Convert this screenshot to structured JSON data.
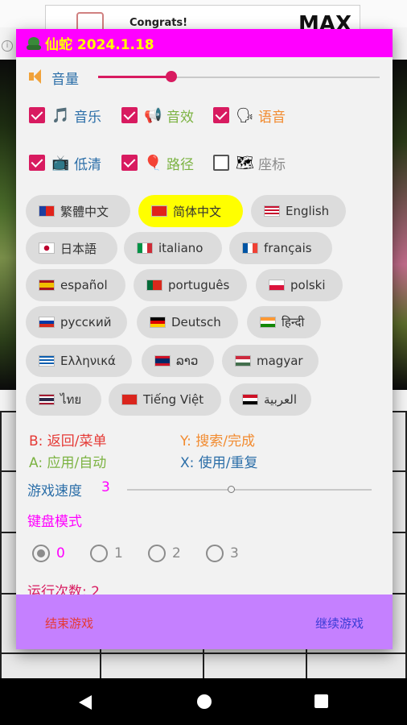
{
  "banner": {
    "title": "Congrats!",
    "badge": "MAX"
  },
  "info_icon": "i",
  "dialog": {
    "title": "仙蛇 2024.1.18",
    "volume": {
      "label": "音量",
      "level": 0.26
    },
    "checks_row1": [
      {
        "icon": "music-note-icon",
        "glyph": "🎵",
        "label": "音乐",
        "checked": true,
        "color": "#2b6ea8"
      },
      {
        "icon": "megaphone-icon",
        "glyph": "📢",
        "label": "音效",
        "checked": true,
        "color": "#7cb342"
      },
      {
        "icon": "speaking-head-icon",
        "glyph": "🗣",
        "label": "语音",
        "checked": true,
        "color": "#f28b30"
      }
    ],
    "checks_row2": [
      {
        "icon": "tv-icon",
        "glyph": "📺",
        "label": "低清",
        "checked": true,
        "color": "#2b6ea8"
      },
      {
        "icon": "balloon-icon",
        "glyph": "🎈",
        "label": "路径",
        "checked": true,
        "color": "#7cb342"
      },
      {
        "icon": "map-icon",
        "glyph": "🗺",
        "label": "座标",
        "checked": false,
        "color": "#8a8a8a"
      }
    ],
    "languages": [
      {
        "label": "繁體中文",
        "flag": "tw",
        "selected": false
      },
      {
        "label": "简体中文",
        "flag": "cn",
        "selected": true
      },
      {
        "label": "English",
        "flag": "us",
        "selected": false
      },
      {
        "label": "日本語",
        "flag": "jp",
        "selected": false
      },
      {
        "label": "italiano",
        "flag": "it",
        "selected": false
      },
      {
        "label": "français",
        "flag": "fr",
        "selected": false
      },
      {
        "label": "español",
        "flag": "es",
        "selected": false
      },
      {
        "label": "português",
        "flag": "pt",
        "selected": false
      },
      {
        "label": "polski",
        "flag": "pl",
        "selected": false
      },
      {
        "label": "русский",
        "flag": "ru",
        "selected": false
      },
      {
        "label": "Deutsch",
        "flag": "de",
        "selected": false
      },
      {
        "label": "हिन्दी",
        "flag": "in",
        "selected": false
      },
      {
        "label": "Ελληνικά",
        "flag": "gr",
        "selected": false
      },
      {
        "label": "ລາວ",
        "flag": "la",
        "selected": false
      },
      {
        "label": "magyar",
        "flag": "hu",
        "selected": false
      },
      {
        "label": "ไทย",
        "flag": "th",
        "selected": false
      },
      {
        "label": "Tiếng Việt",
        "flag": "vn",
        "selected": false
      },
      {
        "label": "العربية",
        "flag": "eg",
        "selected": false
      }
    ],
    "keys": {
      "b": {
        "text": "B: 返回/菜单",
        "color": "#e53935"
      },
      "y": {
        "text": "Y: 搜索/完成",
        "color": "#f28b30"
      },
      "a": {
        "text": "A: 应用/自动",
        "color": "#7cb342"
      },
      "x": {
        "text": "X: 使用/重复",
        "color": "#2b6ea8"
      }
    },
    "speed": {
      "label": "游戏速度",
      "value": "3"
    },
    "keyboard_mode": {
      "label": "键盘模式",
      "options": [
        "0",
        "1",
        "2",
        "3"
      ],
      "selected": "0"
    },
    "runs": "运行次数: 2",
    "footer": {
      "end": "结束游戏",
      "continue": "继续游戏"
    }
  },
  "colors": {
    "title_bar": "#ff00ff",
    "title_text": "#ffff00",
    "accent": "#d81b60",
    "footer": "#c580ff",
    "selected_chip": "#ffff00"
  }
}
